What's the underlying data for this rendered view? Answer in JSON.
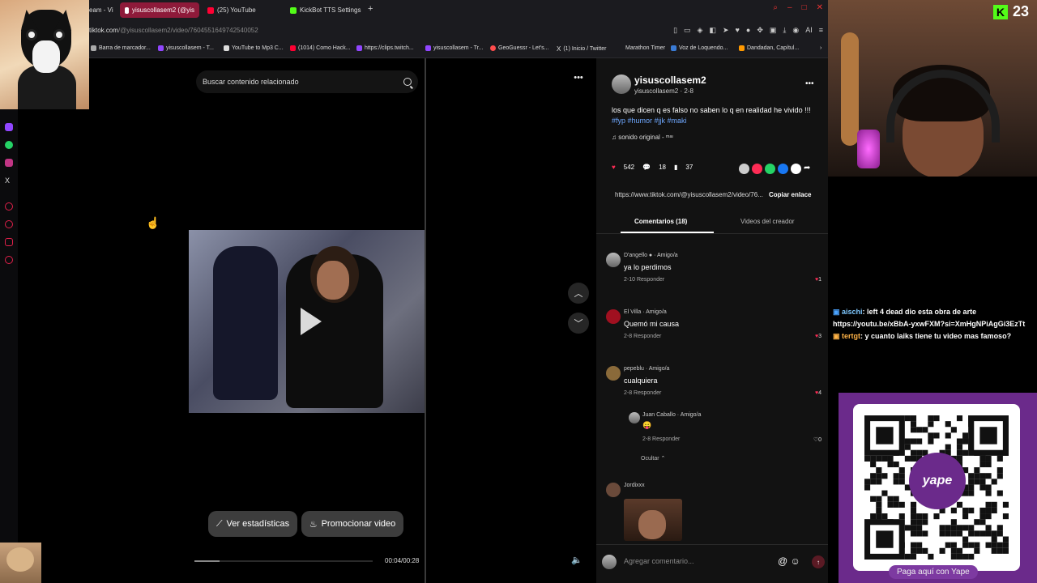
{
  "browser": {
    "tabs": [
      {
        "label": "eam - Vi",
        "active": false,
        "color": "#555555"
      },
      {
        "label": "yisuscollasem2 (@yis",
        "active": true,
        "color": "#ffffff"
      },
      {
        "label": "(25) YouTube",
        "active": false,
        "color": "#ff0033"
      },
      {
        "label": "KickBot TTS Settings",
        "active": false,
        "color": "#53fc18"
      }
    ],
    "url_host": "tiktok.com",
    "url_path": "/@yisuscollasem2/video/7604551649742540052",
    "bookmarks": [
      {
        "label": "Barra de marcador...",
        "color": "#aaaaaa"
      },
      {
        "label": "yisuscollasem - T...",
        "color": "#9146ff"
      },
      {
        "label": "YouTube to Mp3 C...",
        "color": "#dddddd"
      },
      {
        "label": "(1014) Como Hack...",
        "color": "#ff0033"
      },
      {
        "label": "https://clips.twitch...",
        "color": "#9146ff"
      },
      {
        "label": "yisuscollasem - Tr...",
        "color": "#9146ff"
      },
      {
        "label": "GeoGuessr - Let's...",
        "color": "#ff4d4d"
      },
      {
        "label": "(1) Inicio / Twitter",
        "color": "#dddddd"
      },
      {
        "label": "Marathon Timer",
        "color": "#444444"
      },
      {
        "label": "Voz de Loquendo...",
        "color": "#3a7bd5"
      },
      {
        "label": "Dandadan, Capítul...",
        "color": "#ff9900"
      }
    ],
    "ai_label": "AI"
  },
  "kick": {
    "count": "23"
  },
  "search": {
    "placeholder": "Buscar contenido relacionado"
  },
  "video": {
    "time": "00:04/00:28",
    "progress": 0.14,
    "stats_button": "Ver estadísticas",
    "promote_button": "Promocionar video"
  },
  "post": {
    "username": "yisuscollasem2",
    "sub": "yisuscollasem2 · 2-8",
    "description": "los que dicen q es falso no saben lo q en realidad he vivido !!!",
    "tags": "#fyp #humor #jjk #maki",
    "sound": "sonido original - ᵐᵃᶦ",
    "likes": "542",
    "comments": "18",
    "saves": "37",
    "link": "https://www.tiktok.com/@yisuscollasem2/video/76...",
    "copy_label": "Copiar enlace"
  },
  "tabs": {
    "comments": "Comentarios (18)",
    "creator": "Videos del creador"
  },
  "comments": [
    {
      "name": "D'angello ● · Amigo/a",
      "text": "ya lo perdimos",
      "meta": "2-10    Responder",
      "likes": "1"
    },
    {
      "name": "El Villa · Amigo/a",
      "text": "Quemó mi causa",
      "meta": "2-8    Responder",
      "likes": "3"
    },
    {
      "name": "pepeblu · Amigo/a",
      "text": "cualquiera",
      "meta": "2-8    Responder",
      "likes": "4"
    },
    {
      "name": "Juan Caballo · Amigo/a",
      "text": "😛",
      "meta": "2-8    Responder",
      "likes": "0"
    },
    {
      "name": "Jordixxx",
      "text": "",
      "meta": "",
      "likes": ""
    }
  ],
  "hide_label": "Ocultar ⌃",
  "comment_input": {
    "placeholder": "Agregar comentario..."
  },
  "chat": [
    {
      "user": "aischi",
      "text": ": left 4 dead dio esta obra de arte https://youtu.be/xBbA-yxwFXM?si=XmHgNPiAgGi3EzTt"
    },
    {
      "user": "tertgt",
      "text": ": y cuanto laiks tiene tu video mas famoso?"
    }
  ],
  "yape": {
    "logo": "yape",
    "caption": "Paga aquí con Yape"
  },
  "colors": {
    "accent": "#fe2c55",
    "brand_kick": "#53fc18",
    "yape": "#6b2a8b"
  }
}
